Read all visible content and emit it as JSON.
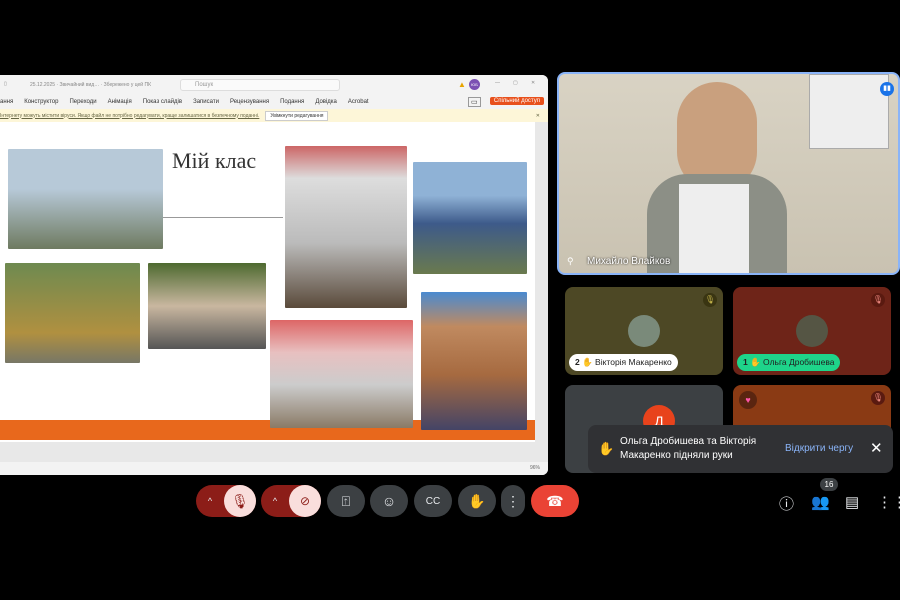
{
  "app_window": {
    "title_path": "25.12.2025 · Звичайний вид… · Збережено у цей ПК",
    "search_placeholder": "Пошук",
    "user_initials": "ЮБ",
    "ribbon_tabs": [
      "ання",
      "Конструктор",
      "Переходи",
      "Анімація",
      "Показ слайдів",
      "Записати",
      "Рецензування",
      "Подання",
      "Довідка",
      "Acrobat"
    ],
    "share_button": "Спільний доступ",
    "warning_text": "Інтернету можуть містити віруси. Якщо файл не потрібно редагувати, краще залишатися в безпечному поданні.",
    "enable_editing": "Увімкнути редагування",
    "zoom_level": "96%"
  },
  "slide": {
    "title": "Мій клас"
  },
  "main_video": {
    "name": "Михайло Влайков"
  },
  "tiles": [
    {
      "name": "Вікторія Макаренко",
      "hand_order": "2"
    },
    {
      "name": "Ольга Дробишева",
      "hand_order": "1"
    },
    {
      "initial": "Д"
    },
    {}
  ],
  "toast": {
    "message": "Ольга Дробишева та Вікторія Макаренко підняли руки",
    "action": "Відкрити чергу"
  },
  "participants_count": "16",
  "colors": {
    "end_call": "#ea4335",
    "muted_bg": "#f9dedc",
    "accent": "#8ab4f8"
  }
}
